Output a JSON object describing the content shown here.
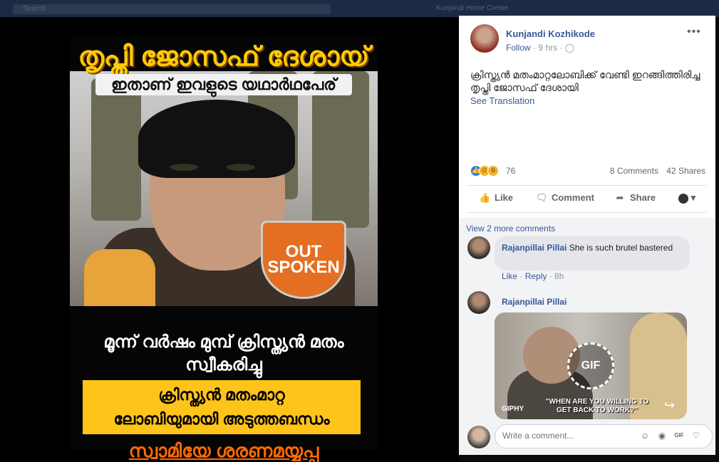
{
  "background": {
    "search_placeholder": "Search",
    "nav_text": "Kunjandi    Home    Create"
  },
  "poster": {
    "title": "തൃപ്തി ജോസഫ് ദേശായ്",
    "subtitle": "ഇതാണ് ഇവളുടെ യഥാർഥപേര്",
    "logo_text": "OUT SPOKEN",
    "line1": "മൂന്ന് വർഷം മുമ്പ് ക്രിസ്ത്യൻ മതം",
    "line2": "സ്വീകരിച്ചു",
    "box_line1": "ക്രിസ്ത്യൻ മതംമാറ്റ",
    "box_line2": "ലോബിയുമായി അടുത്തബന്ധം",
    "footer": "സ്വാമിയേ ശരണമയ്യപ്പ"
  },
  "post": {
    "author": "Kunjandi Kozhikode",
    "follow": "Follow",
    "time": "· 9 hrs ·",
    "privacy_icon": "globe-icon",
    "text": "ക്രിസ്ത്യൻ മതംമാറ്റലോബിക്ക് വേണ്ടി ഇറങ്ങിത്തിരിച്ച തൃപ്തി ജോസഫ് ദേശായി",
    "see_translation": "See Translation",
    "reaction_count": "76",
    "comments_count": "8 Comments",
    "shares_count": "42 Shares"
  },
  "actions": {
    "like": "Like",
    "comment": "Comment",
    "share": "Share"
  },
  "comments": {
    "view_more": "View 2 more comments",
    "items": [
      {
        "name": "Rajanpillai Pillai",
        "text": "She is such brutel bastered",
        "like": "Like",
        "reply": "Reply",
        "time": "8h"
      },
      {
        "name": "Rajanpillai Pillai",
        "gif_badge": "GIF",
        "gif_caption": "\"WHEN ARE YOU WILLING TO GET BACK TO WORK?\"",
        "gif_brand": "GIPHY"
      }
    ],
    "write_placeholder": "Write a comment..."
  },
  "colors": {
    "link": "#385898",
    "poster_yellow": "#ffc41a",
    "poster_orange": "#ff6a00"
  }
}
